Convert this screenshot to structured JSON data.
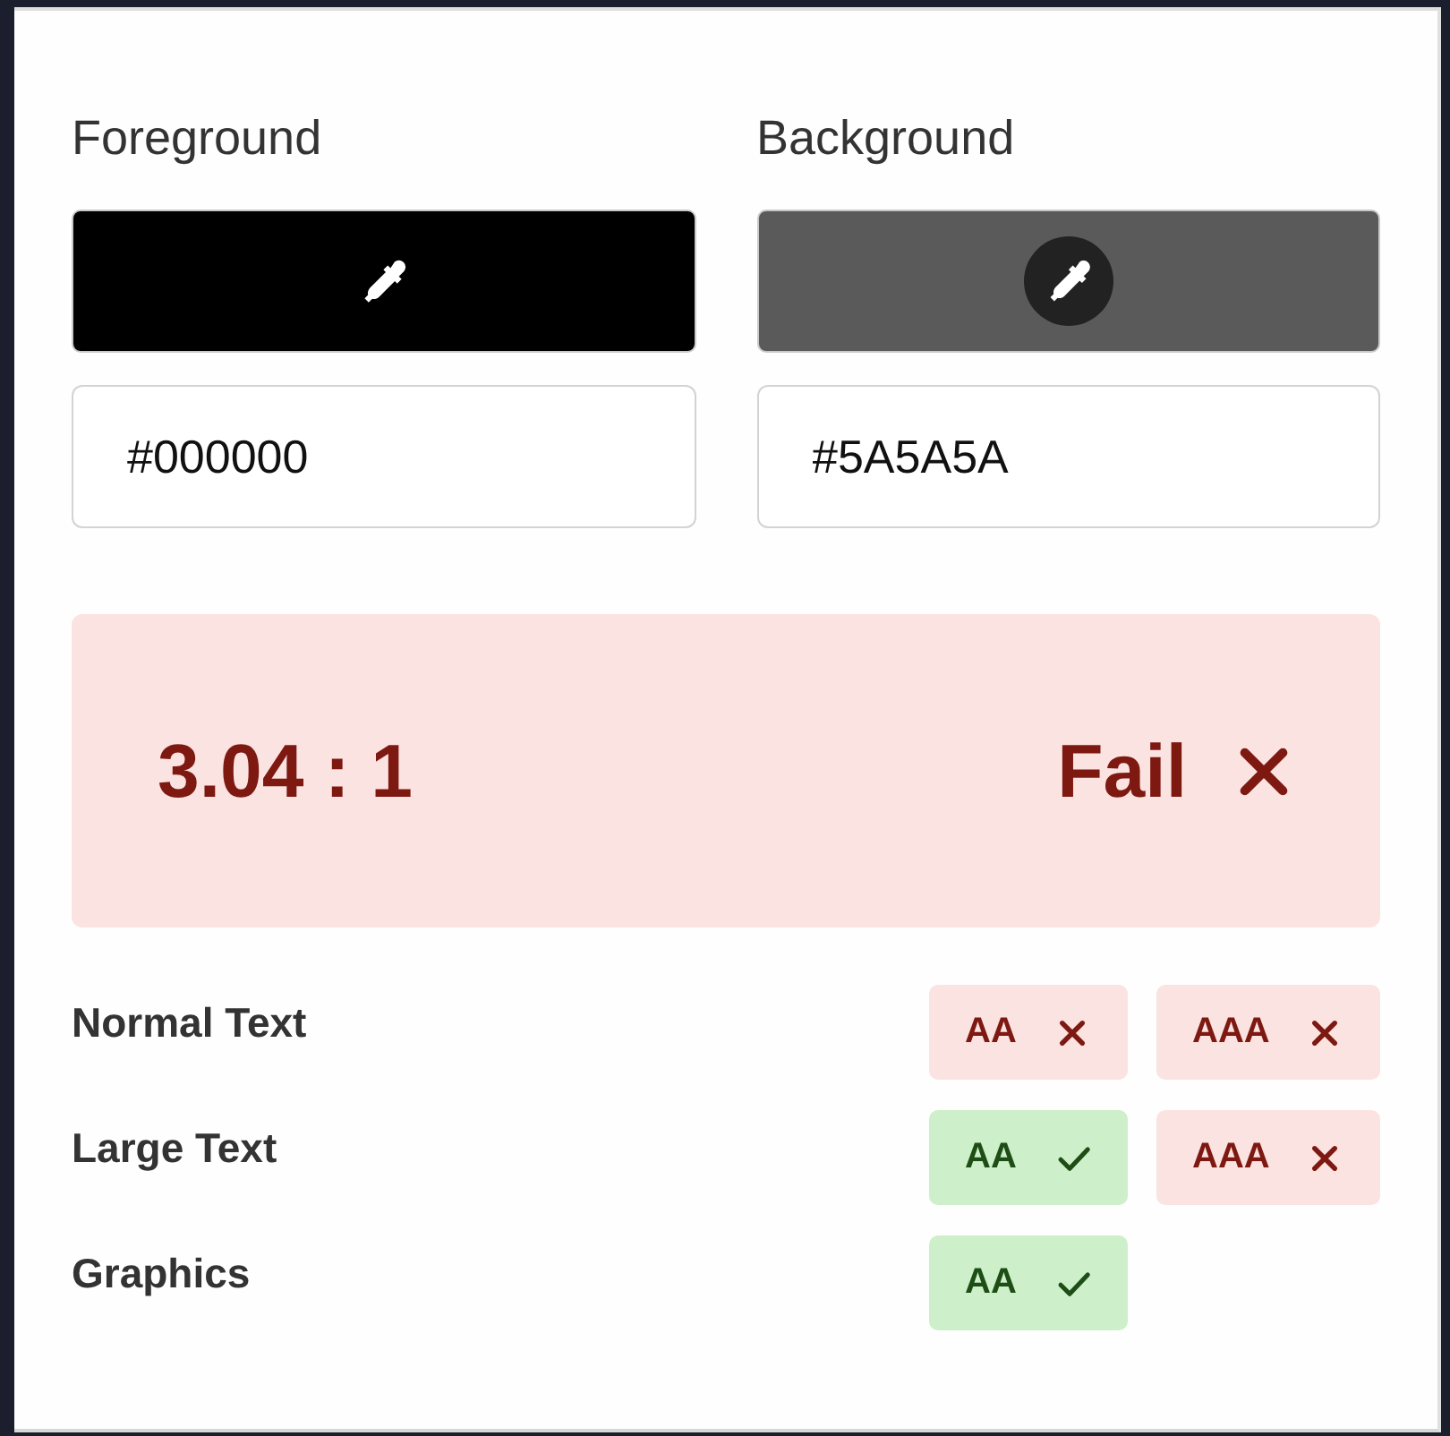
{
  "pickers": [
    {
      "label": "Foreground",
      "color": "#000000",
      "value": "#000000"
    },
    {
      "label": "Background",
      "color": "#5a5a5a",
      "value": "#5A5A5A"
    }
  ],
  "result": {
    "ratio": "3.04 : 1",
    "verdict": "Fail",
    "passed": false
  },
  "levels": [
    {
      "name": "Normal Text",
      "badges": [
        {
          "label": "AA",
          "passed": false
        },
        {
          "label": "AAA",
          "passed": false
        }
      ]
    },
    {
      "name": "Large Text",
      "badges": [
        {
          "label": "AA",
          "passed": true
        },
        {
          "label": "AAA",
          "passed": false
        }
      ]
    },
    {
      "name": "Graphics",
      "badges": [
        {
          "label": "AA",
          "passed": true
        }
      ]
    }
  ]
}
